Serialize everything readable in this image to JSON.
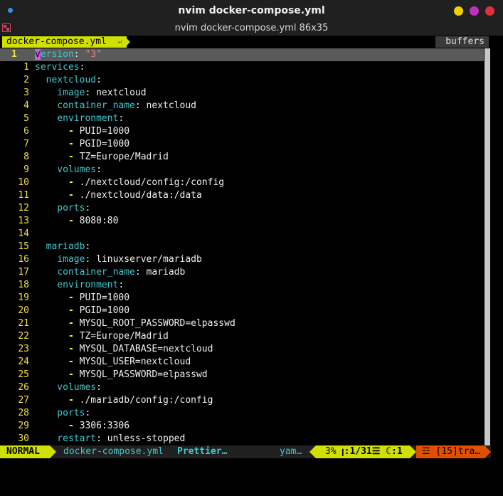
{
  "window": {
    "title": "nvim docker-compose.yml",
    "subtitle": "nvim docker-compose.yml 86x35"
  },
  "tabline": {
    "active_tab": "docker-compose.yml",
    "tab_modified_icon": "↩",
    "buffers_label": "buffers"
  },
  "editor": {
    "current_line_number": "1",
    "lines": [
      {
        "ln": "1",
        "parts": [
          {
            "t": "v",
            "c": "k"
          },
          {
            "t": "ersion",
            "c": "k"
          },
          {
            "t": ": ",
            "c": "v"
          },
          {
            "t": "\"3\"",
            "c": "s"
          }
        ]
      },
      {
        "ln": "1",
        "parts": [
          {
            "t": "services",
            "c": "k"
          },
          {
            "t": ":",
            "c": "v"
          }
        ]
      },
      {
        "ln": "2",
        "parts": [
          {
            "t": "  nextcloud",
            "c": "k"
          },
          {
            "t": ":",
            "c": "v"
          }
        ]
      },
      {
        "ln": "3",
        "parts": [
          {
            "t": "    image",
            "c": "k"
          },
          {
            "t": ": nextcloud",
            "c": "v"
          }
        ]
      },
      {
        "ln": "4",
        "parts": [
          {
            "t": "    container_name",
            "c": "k"
          },
          {
            "t": ": nextcloud",
            "c": "v"
          }
        ]
      },
      {
        "ln": "5",
        "parts": [
          {
            "t": "    environment",
            "c": "k"
          },
          {
            "t": ":",
            "c": "v"
          }
        ]
      },
      {
        "ln": "6",
        "parts": [
          {
            "t": "      - ",
            "c": "d"
          },
          {
            "t": "PUID=1000",
            "c": "v"
          }
        ]
      },
      {
        "ln": "7",
        "parts": [
          {
            "t": "      - ",
            "c": "d"
          },
          {
            "t": "PGID=1000",
            "c": "v"
          }
        ]
      },
      {
        "ln": "8",
        "parts": [
          {
            "t": "      - ",
            "c": "d"
          },
          {
            "t": "TZ=Europe/Madrid",
            "c": "v"
          }
        ]
      },
      {
        "ln": "9",
        "parts": [
          {
            "t": "    volumes",
            "c": "k"
          },
          {
            "t": ":",
            "c": "v"
          }
        ]
      },
      {
        "ln": "10",
        "parts": [
          {
            "t": "      - ",
            "c": "d"
          },
          {
            "t": "./nextcloud/config:/config",
            "c": "v"
          }
        ]
      },
      {
        "ln": "11",
        "parts": [
          {
            "t": "      - ",
            "c": "d"
          },
          {
            "t": "./nextcloud/data:/data",
            "c": "v"
          }
        ]
      },
      {
        "ln": "12",
        "parts": [
          {
            "t": "    ports",
            "c": "k"
          },
          {
            "t": ":",
            "c": "v"
          }
        ]
      },
      {
        "ln": "13",
        "parts": [
          {
            "t": "      - ",
            "c": "d"
          },
          {
            "t": "8080:80",
            "c": "v"
          }
        ]
      },
      {
        "ln": "14",
        "parts": []
      },
      {
        "ln": "15",
        "parts": [
          {
            "t": "  mariadb",
            "c": "k"
          },
          {
            "t": ":",
            "c": "v"
          }
        ]
      },
      {
        "ln": "16",
        "parts": [
          {
            "t": "    image",
            "c": "k"
          },
          {
            "t": ": linuxserver/mariadb",
            "c": "v"
          }
        ]
      },
      {
        "ln": "17",
        "parts": [
          {
            "t": "    container_name",
            "c": "k"
          },
          {
            "t": ": mariadb",
            "c": "v"
          }
        ]
      },
      {
        "ln": "18",
        "parts": [
          {
            "t": "    environment",
            "c": "k"
          },
          {
            "t": ":",
            "c": "v"
          }
        ]
      },
      {
        "ln": "19",
        "parts": [
          {
            "t": "      - ",
            "c": "d"
          },
          {
            "t": "PUID=1000",
            "c": "v"
          }
        ]
      },
      {
        "ln": "20",
        "parts": [
          {
            "t": "      - ",
            "c": "d"
          },
          {
            "t": "PGID=1000",
            "c": "v"
          }
        ]
      },
      {
        "ln": "21",
        "parts": [
          {
            "t": "      - ",
            "c": "d"
          },
          {
            "t": "MYSQL_ROOT_PASSWORD=elpasswd",
            "c": "v"
          }
        ]
      },
      {
        "ln": "22",
        "parts": [
          {
            "t": "      - ",
            "c": "d"
          },
          {
            "t": "TZ=Europe/Madrid",
            "c": "v"
          }
        ]
      },
      {
        "ln": "23",
        "parts": [
          {
            "t": "      - ",
            "c": "d"
          },
          {
            "t": "MYSQL_DATABASE=nextcloud",
            "c": "v"
          }
        ]
      },
      {
        "ln": "24",
        "parts": [
          {
            "t": "      - ",
            "c": "d"
          },
          {
            "t": "MYSQL_USER=nextcloud",
            "c": "v"
          }
        ]
      },
      {
        "ln": "25",
        "parts": [
          {
            "t": "      - ",
            "c": "d"
          },
          {
            "t": "MYSQL_PASSWORD=elpasswd",
            "c": "v"
          }
        ]
      },
      {
        "ln": "26",
        "parts": [
          {
            "t": "    volumes",
            "c": "k"
          },
          {
            "t": ":",
            "c": "v"
          }
        ]
      },
      {
        "ln": "27",
        "parts": [
          {
            "t": "      - ",
            "c": "d"
          },
          {
            "t": "./mariadb/config:/config",
            "c": "v"
          }
        ]
      },
      {
        "ln": "28",
        "parts": [
          {
            "t": "    ports",
            "c": "k"
          },
          {
            "t": ":",
            "c": "v"
          }
        ]
      },
      {
        "ln": "29",
        "parts": [
          {
            "t": "      - ",
            "c": "d"
          },
          {
            "t": "3306:3306",
            "c": "v"
          }
        ]
      },
      {
        "ln": "30",
        "parts": [
          {
            "t": "    restart",
            "c": "k"
          },
          {
            "t": ": unless-stopped",
            "c": "v"
          }
        ]
      }
    ]
  },
  "statusline": {
    "mode": "NORMAL",
    "filename": "docker-compose.yml",
    "formatter": "Prettier…",
    "filetype": "yam…",
    "percent": "3%",
    "position": "ꞁ:1/31☰ ℂ:1",
    "trailing": "☲ [15]tra…"
  },
  "colors": {
    "accent": "#d0e000",
    "keyword": "#40c8d0",
    "string": "#f08080",
    "linenr": "#f0e040",
    "warning": "#e05000"
  }
}
